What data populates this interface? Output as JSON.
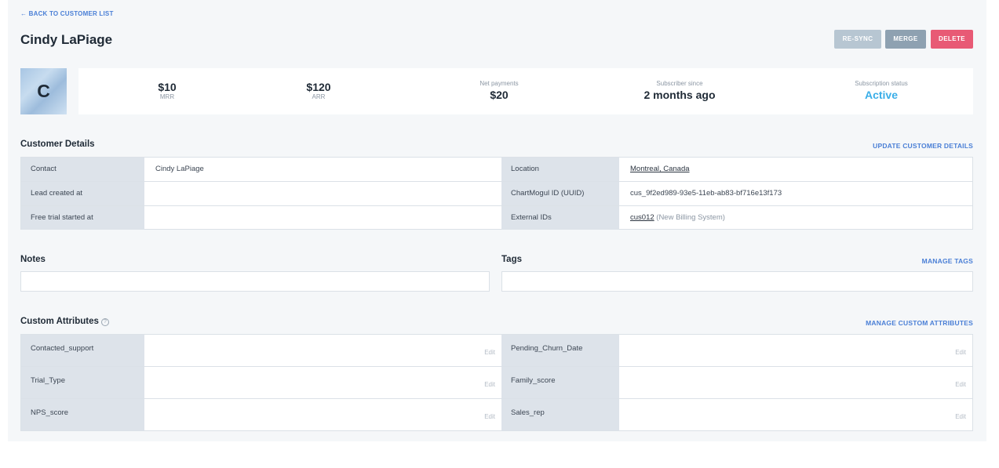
{
  "nav": {
    "back_label": "← BACK TO CUSTOMER LIST"
  },
  "customer": {
    "name": "Cindy LaPiage",
    "initial": "C"
  },
  "actions": {
    "resync": "RE-SYNC",
    "merge": "MERGE",
    "delete": "DELETE"
  },
  "stats": {
    "mrr": {
      "value": "$10",
      "label": "MRR"
    },
    "arr": {
      "value": "$120",
      "label": "ARR"
    },
    "net_payments": {
      "label": "Net payments",
      "value": "$20"
    },
    "subscriber_since": {
      "label": "Subscriber since",
      "value": "2 months ago"
    },
    "subscription_status": {
      "label": "Subscription status",
      "value": "Active"
    }
  },
  "details": {
    "title": "Customer Details",
    "update_link": "UPDATE CUSTOMER DETAILS",
    "rows": [
      {
        "left_label": "Contact",
        "left_value": "Cindy LaPiage",
        "right_label": "Location",
        "right_value": "Montreal, Canada"
      },
      {
        "left_label": "Lead created at",
        "left_value": "",
        "right_label": "ChartMogul ID (UUID)",
        "right_value": "cus_9f2ed989-93e5-11eb-ab83-bf716e13f173"
      },
      {
        "left_label": "Free trial started at",
        "left_value": "",
        "right_label": "External IDs",
        "right_value": "cus012",
        "right_value_extra": "(New Billing System)"
      }
    ]
  },
  "notes": {
    "title": "Notes",
    "value": ""
  },
  "tags": {
    "title": "Tags",
    "manage_link": "MANAGE TAGS",
    "value": ""
  },
  "custom_attributes": {
    "title": "Custom Attributes",
    "help_icon": "?",
    "manage_link": "MANAGE CUSTOM ATTRIBUTES",
    "edit_label": "Edit",
    "rows": [
      {
        "left_label": "Contacted_support",
        "right_label": "Pending_Churn_Date"
      },
      {
        "left_label": "Trial_Type",
        "right_label": "Family_score"
      },
      {
        "left_label": "NPS_score",
        "right_label": "Sales_rep"
      }
    ]
  },
  "colors": {
    "accent": "#4a7fd6",
    "active": "#3aaee8",
    "delete": "#e85a75",
    "merge": "#8ea1b1",
    "resync": "#b7c6d2"
  }
}
